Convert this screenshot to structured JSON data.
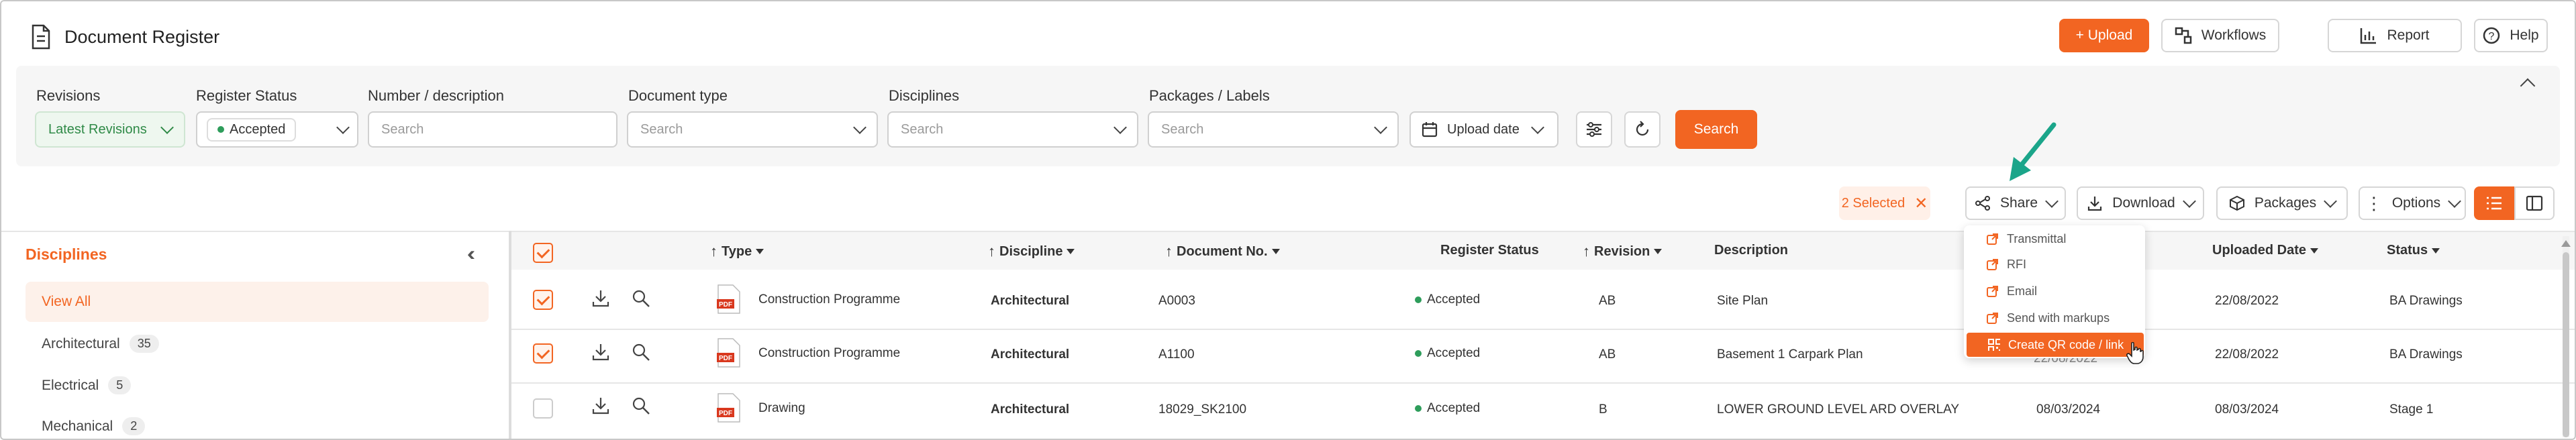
{
  "header": {
    "title": "Document Register",
    "upload_label": "+ Upload",
    "workflows_label": "Workflows",
    "report_label": "Report",
    "help_label": "Help"
  },
  "filters": {
    "revisions": {
      "label": "Revisions",
      "value": "Latest Revisions"
    },
    "register_status": {
      "label": "Register Status",
      "value": "Accepted"
    },
    "number_description": {
      "label": "Number / description",
      "placeholder": "Search"
    },
    "document_type": {
      "label": "Document type",
      "placeholder": "Search"
    },
    "disciplines": {
      "label": "Disciplines",
      "placeholder": "Search"
    },
    "packages_labels": {
      "label": "Packages / Labels",
      "placeholder": "Search"
    },
    "upload_date_label": "Upload date",
    "search_label": "Search"
  },
  "toolbar": {
    "selected_label": "2 Selected",
    "share_label": "Share",
    "download_label": "Download",
    "packages_label": "Packages",
    "options_label": "Options"
  },
  "share_menu": {
    "items": [
      "Transmittal",
      "RFI",
      "Email",
      "Send with markups",
      "Create QR code / link"
    ],
    "active_index": 4
  },
  "sidebar": {
    "title": "Disciplines",
    "items": [
      {
        "label": "View All",
        "count": ""
      },
      {
        "label": "Architectural",
        "count": "35"
      },
      {
        "label": "Electrical",
        "count": "5"
      },
      {
        "label": "Mechanical",
        "count": "2"
      }
    ]
  },
  "table": {
    "columns": [
      "Type",
      "Discipline",
      "Document No.",
      "Register Status",
      "Revision",
      "Description",
      "Uploaded Date",
      "Status"
    ],
    "rows": [
      {
        "selected": true,
        "type": "Construction Programme",
        "discipline": "Architectural",
        "doc_no": "A0003",
        "register_status": "Accepted",
        "revision": "AB",
        "description": "Site Plan",
        "date1": "",
        "uploaded": "22/08/2022",
        "status": "BA Drawings"
      },
      {
        "selected": true,
        "type": "Construction Programme",
        "discipline": "Architectural",
        "doc_no": "A1100",
        "register_status": "Accepted",
        "revision": "AB",
        "description": "Basement 1 Carpark Plan",
        "date1": "22/08/2022",
        "uploaded": "22/08/2022",
        "status": "BA Drawings"
      },
      {
        "selected": false,
        "type": "Drawing",
        "discipline": "Architectural",
        "doc_no": "18029_SK2100",
        "register_status": "Accepted",
        "revision": "B",
        "description": "LOWER GROUND LEVEL ARD OVERLAY",
        "date1": "08/03/2024",
        "uploaded": "08/03/2024",
        "status": "Stage 1"
      }
    ]
  },
  "colors": {
    "accent": "#f26522",
    "status_green": "#2e9d5b",
    "annotation_arrow": "#1ba58a"
  },
  "icons": [
    "document-icon",
    "workflows-icon",
    "report-icon",
    "help-icon",
    "calendar-icon",
    "filter-settings-icon",
    "reset-icon",
    "share-icon",
    "download-icon",
    "package-icon",
    "options-icon",
    "list-view-icon",
    "split-view-icon",
    "collapse-icon",
    "pdf-icon",
    "search-icon",
    "qr-code-icon"
  ]
}
